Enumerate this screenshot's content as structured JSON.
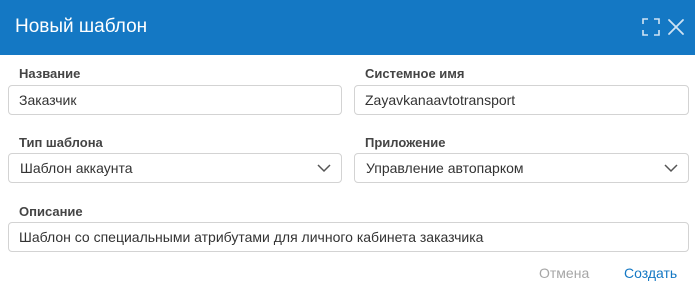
{
  "dialog": {
    "title": "Новый шаблон",
    "icons": {
      "expand": "expand-icon",
      "close": "close-icon"
    }
  },
  "form": {
    "name": {
      "label": "Название",
      "value": "Заказчик"
    },
    "system_name": {
      "label": "Системное имя",
      "value": "Zayavkanaavtotransport"
    },
    "template_type": {
      "label": "Тип шаблона",
      "value": "Шаблон аккаунта"
    },
    "application": {
      "label": "Приложение",
      "value": "Управление автопарком"
    },
    "description": {
      "label": "Описание",
      "value": "Шаблон со специальными атрибутами для личного кабинета заказчика"
    }
  },
  "buttons": {
    "cancel": "Отмена",
    "create": "Создать"
  },
  "colors": {
    "header": "#1478c4",
    "primary_link": "#1478c4",
    "muted_link": "#a6a6a6"
  }
}
